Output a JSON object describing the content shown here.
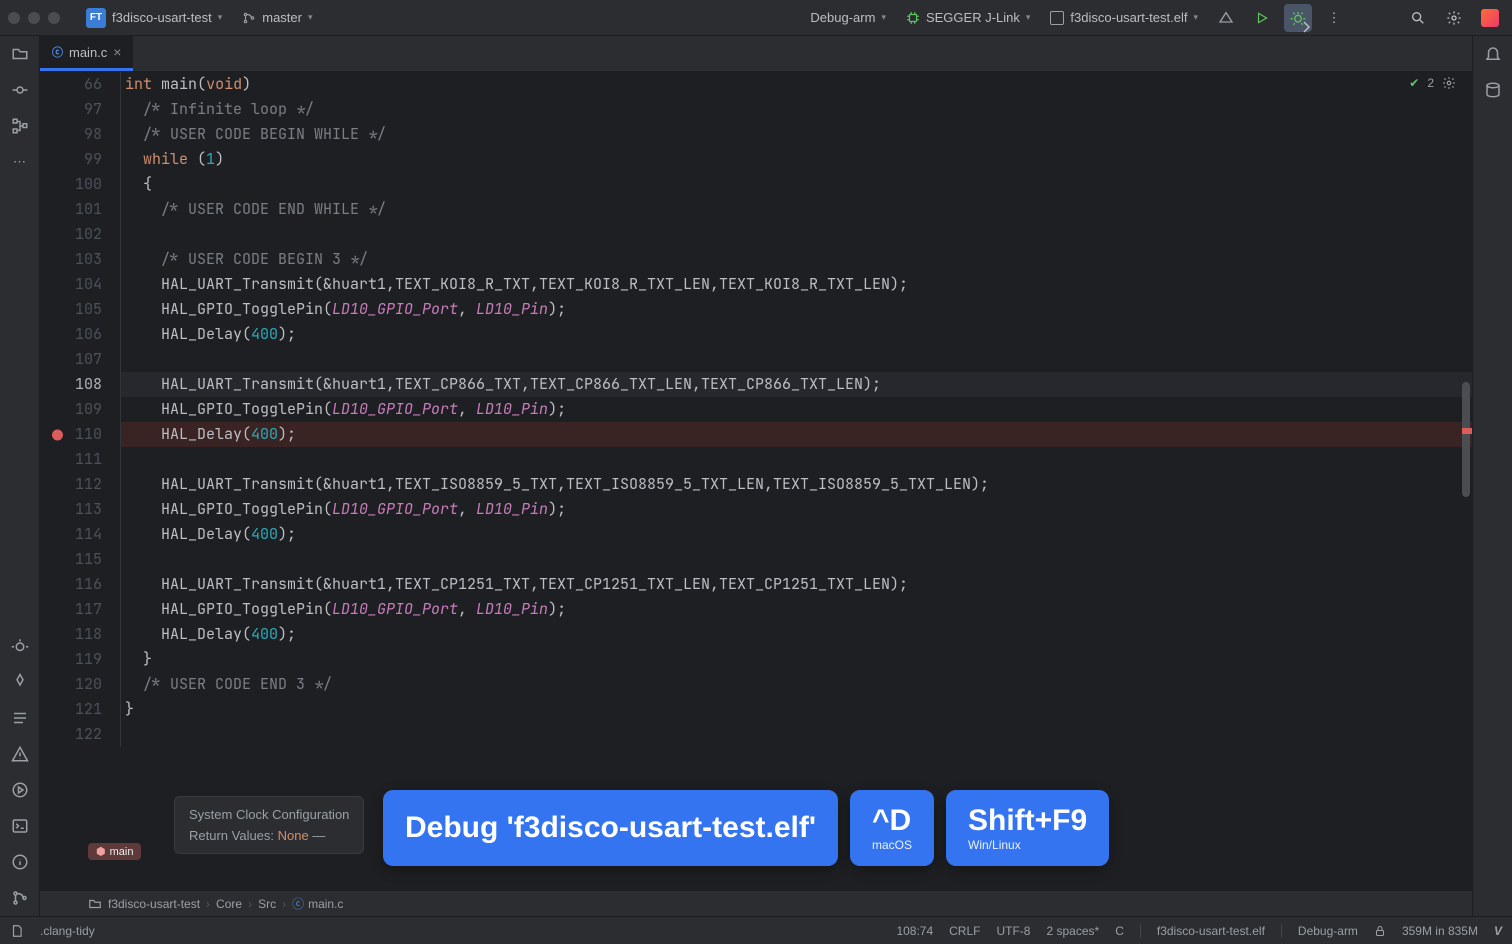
{
  "topbar": {
    "project_badge": "FT",
    "project_name": "f3disco-usart-test",
    "branch": "master",
    "run_config": "Debug-arm",
    "debugger": "SEGGER J-Link",
    "target": "f3disco-usart-test.elf"
  },
  "tab": {
    "filename": "main.c"
  },
  "editor_badge": {
    "count": "2"
  },
  "lines": [
    {
      "n": "66",
      "t": "int main(void)"
    },
    {
      "n": "97",
      "t": "  /* Infinite loop */"
    },
    {
      "n": "98",
      "t": "  /* USER CODE BEGIN WHILE */"
    },
    {
      "n": "99",
      "t": "  while (1)"
    },
    {
      "n": "100",
      "t": "  {"
    },
    {
      "n": "101",
      "t": "    /* USER CODE END WHILE */"
    },
    {
      "n": "102",
      "t": ""
    },
    {
      "n": "103",
      "t": "    /* USER CODE BEGIN 3 */"
    },
    {
      "n": "104",
      "t": "    HAL_UART_Transmit(&huart1,TEXT_KOI8_R_TXT,TEXT_KOI8_R_TXT_LEN,TEXT_KOI8_R_TXT_LEN);"
    },
    {
      "n": "105",
      "t": "    HAL_GPIO_TogglePin(LD10_GPIO_Port, LD10_Pin);"
    },
    {
      "n": "106",
      "t": "    HAL_Delay(400);"
    },
    {
      "n": "107",
      "t": ""
    },
    {
      "n": "108",
      "t": "    HAL_UART_Transmit(&huart1,TEXT_CP866_TXT,TEXT_CP866_TXT_LEN,TEXT_CP866_TXT_LEN);",
      "cursor": true
    },
    {
      "n": "109",
      "t": "    HAL_GPIO_TogglePin(LD10_GPIO_Port, LD10_Pin);"
    },
    {
      "n": "110",
      "t": "    HAL_Delay(400);",
      "bp": true
    },
    {
      "n": "111",
      "t": ""
    },
    {
      "n": "112",
      "t": "    HAL_UART_Transmit(&huart1,TEXT_ISO8859_5_TXT,TEXT_ISO8859_5_TXT_LEN,TEXT_ISO8859_5_TXT_LEN);"
    },
    {
      "n": "113",
      "t": "    HAL_GPIO_TogglePin(LD10_GPIO_Port, LD10_Pin);"
    },
    {
      "n": "114",
      "t": "    HAL_Delay(400);"
    },
    {
      "n": "115",
      "t": ""
    },
    {
      "n": "116",
      "t": "    HAL_UART_Transmit(&huart1,TEXT_CP1251_TXT,TEXT_CP1251_TXT_LEN,TEXT_CP1251_TXT_LEN);"
    },
    {
      "n": "117",
      "t": "    HAL_GPIO_TogglePin(LD10_GPIO_Port, LD10_Pin);"
    },
    {
      "n": "118",
      "t": "    HAL_Delay(400);"
    },
    {
      "n": "119",
      "t": "  }"
    },
    {
      "n": "120",
      "t": "  /* USER CODE END 3 */"
    },
    {
      "n": "121",
      "t": "}"
    },
    {
      "n": "122",
      "t": ""
    }
  ],
  "doc_hint": {
    "title": "System Clock Configuration",
    "returns_label": "Return Values:",
    "returns_val": "None",
    "dash": "—"
  },
  "overlay": {
    "main": "Debug 'f3disco-usart-test.elf'",
    "mac_key": "^D",
    "mac_sub": "macOS",
    "win_key": "Shift+F9",
    "win_sub": "Win/Linux"
  },
  "breadcrumb_badge": "main",
  "breadcrumbs": [
    "f3disco-usart-test",
    "Core",
    "Src",
    "main.c"
  ],
  "status": {
    "clang": ".clang-tidy",
    "pos": "108:74",
    "eol": "CRLF",
    "enc": "UTF-8",
    "indent": "2 spaces*",
    "lang": "C",
    "ctx": "f3disco-usart-test.elf",
    "cfg": "Debug-arm",
    "mem": "359M in 835M"
  }
}
